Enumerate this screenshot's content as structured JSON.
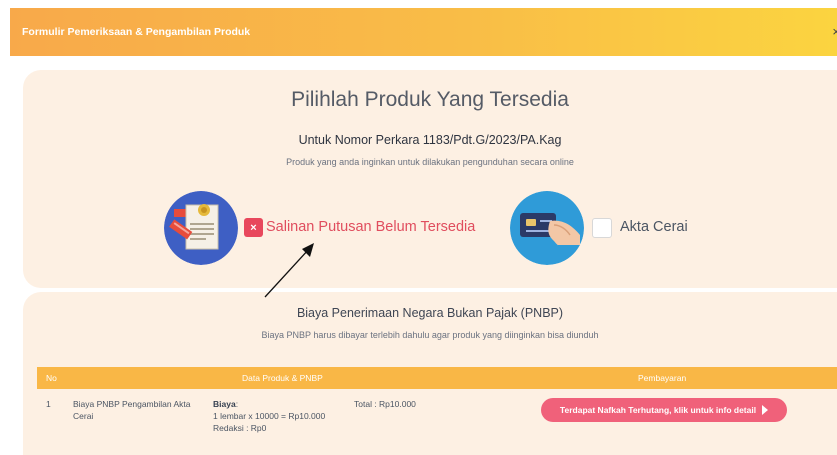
{
  "modal": {
    "title": "Formulir Pemeriksaan & Pengambilan Produk",
    "close_glyph": "×"
  },
  "products_section": {
    "heading": "Pilihlah Produk Yang Tersedia",
    "case_line": "Untuk Nomor Perkara 1183/Pdt.G/2023/PA.Kag",
    "subtitle": "Produk yang anda inginkan untuk dilakukan pengunduhan secara online",
    "items": [
      {
        "icon": "document-stamp-icon",
        "checkbox_glyph": "×",
        "label": "Salinan Putusan Belum Tersedia",
        "available": false,
        "label_color": "#e04d5e"
      },
      {
        "icon": "card-hand-icon",
        "label": "Akta Cerai",
        "checked": false
      }
    ]
  },
  "pnbp_section": {
    "title": "Biaya Penerimaan Negara Bukan Pajak (PNBP)",
    "subtitle": "Biaya PNBP harus dibayar terlebih dahulu agar produk yang diinginkan bisa diunduh",
    "table": {
      "headers": {
        "no": "No",
        "data": "Data Produk & PNBP",
        "payment": "Pembayaran"
      },
      "rows": [
        {
          "no": "1",
          "description": "Biaya PNBP Pengambilan Akta Cerai",
          "biaya_label": "Biaya",
          "biaya_suffix": ":",
          "biaya_detail": "1 lembar x 10000 = Rp10.000",
          "redaksi": "Redaksi : Rp0",
          "total": "Total : Rp10.000",
          "payment_button": "Terdapat Nafkah Terhutang, klik untuk info detail"
        }
      ]
    }
  },
  "colors": {
    "header_gradient_start": "#f8a94a",
    "header_gradient_end": "#fbd440",
    "card_background": "#fdf0e3",
    "unavailable_red": "#e8475c",
    "table_header": "#f9b746",
    "payment_button": "#f0617a"
  }
}
